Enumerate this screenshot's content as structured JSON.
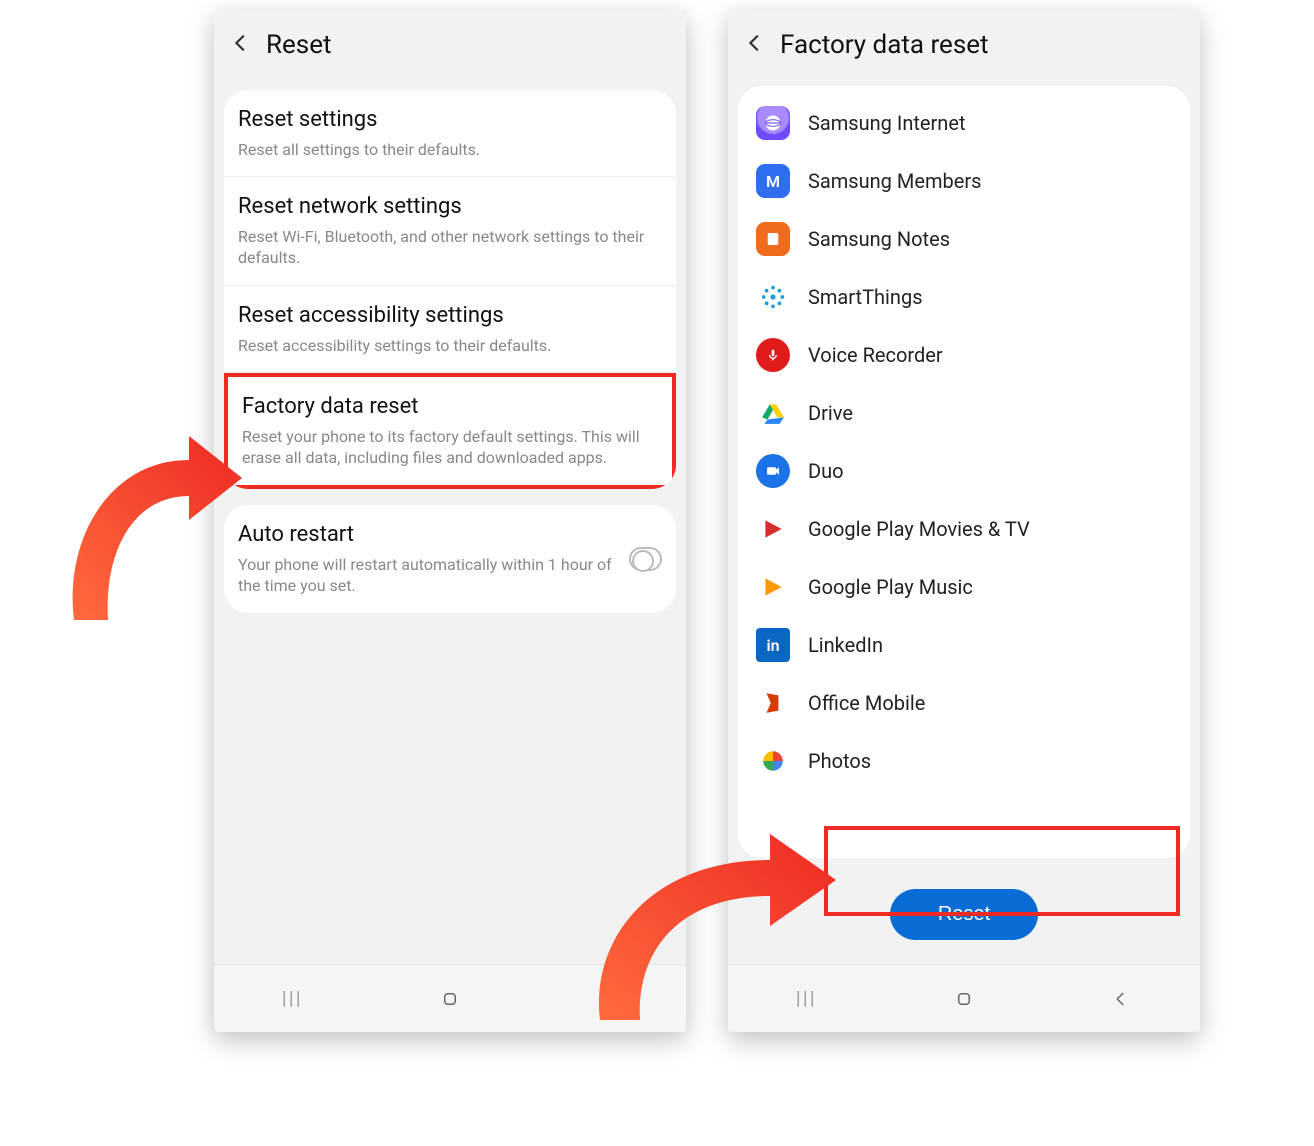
{
  "left": {
    "title": "Reset",
    "items": [
      {
        "title": "Reset settings",
        "desc": "Reset all settings to their defaults."
      },
      {
        "title": "Reset network settings",
        "desc": "Reset Wi-Fi, Bluetooth, and other network settings to their defaults."
      },
      {
        "title": "Reset accessibility settings",
        "desc": "Reset accessibility settings to their defaults."
      },
      {
        "title": "Factory data reset",
        "desc": "Reset your phone to its factory default settings. This will erase all data, including files and downloaded apps."
      }
    ],
    "auto_restart": {
      "title": "Auto restart",
      "desc": "Your phone will restart automatically within 1 hour of the time you set."
    }
  },
  "right": {
    "title": "Factory data reset",
    "apps": [
      {
        "label": "Samsung Internet",
        "icon": "internet"
      },
      {
        "label": "Samsung Members",
        "icon": "members"
      },
      {
        "label": "Samsung Notes",
        "icon": "notes"
      },
      {
        "label": "SmartThings",
        "icon": "smartthings"
      },
      {
        "label": "Voice Recorder",
        "icon": "voice"
      },
      {
        "label": "Drive",
        "icon": "drive"
      },
      {
        "label": "Duo",
        "icon": "duo"
      },
      {
        "label": "Google Play Movies & TV",
        "icon": "movies"
      },
      {
        "label": "Google Play Music",
        "icon": "music"
      },
      {
        "label": "LinkedIn",
        "icon": "linkedin"
      },
      {
        "label": "Office Mobile",
        "icon": "office"
      },
      {
        "label": "Photos",
        "icon": "photos"
      }
    ],
    "reset_label": "Reset"
  }
}
